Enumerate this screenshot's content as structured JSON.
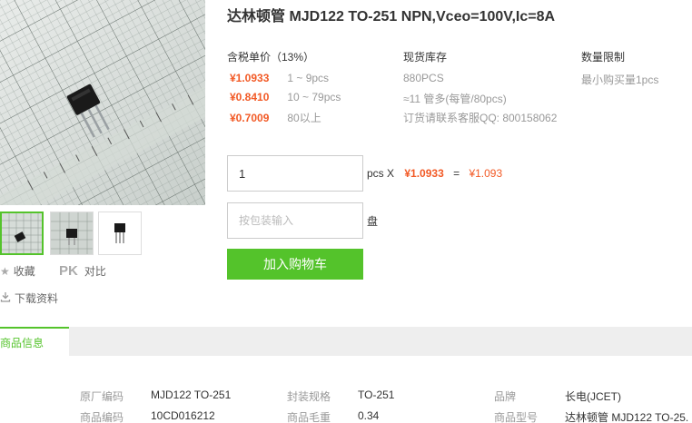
{
  "product": {
    "title": "达林顿管 MJD122 TO-251 NPN,Vceo=100V,Ic=8A"
  },
  "gallery": {
    "main_image_icon": "product-photo-transistor-on-ruler",
    "thumbnails": [
      "thumb-grid-top-view",
      "thumb-grid-side-view",
      "thumb-white-background"
    ]
  },
  "side_actions": {
    "favorite_label": "收藏",
    "pk_mark": "PK",
    "compare_label": "对比",
    "download_label": "下载资料"
  },
  "pricing": {
    "header": "含税单价（13%）",
    "tiers": [
      {
        "price": "¥1.0933",
        "range": "1 ~ 9pcs"
      },
      {
        "price": "¥0.8410",
        "range": "10 ~ 79pcs"
      },
      {
        "price": "¥0.7009",
        "range": "80以上"
      }
    ]
  },
  "stock": {
    "header": "现货库存",
    "lines": [
      "880PCS",
      "≈11 管多(每管/80pcs)",
      "订货请联系客服QQ: 800158062"
    ]
  },
  "limit": {
    "header": "数量限制",
    "text": "最小购买量1pcs"
  },
  "order": {
    "quantity_value": "1",
    "quantity_unit": "pcs X",
    "unit_price": "¥1.0933",
    "equals": "=",
    "total": "¥1.093",
    "pack_placeholder": "按包装输入",
    "pack_unit": "盘",
    "add_to_cart": "加入购物车"
  },
  "tabs": {
    "active": "商品信息"
  },
  "specs": {
    "row1": [
      {
        "label": "原厂编码",
        "value": "MJD122 TO-251"
      },
      {
        "label": "封装规格",
        "value": "TO-251"
      },
      {
        "label": "品牌",
        "value": "长电(JCET)"
      }
    ],
    "row2": [
      {
        "label": "商品编码",
        "value": "10CD016212"
      },
      {
        "label": "商品毛重",
        "value": "0.34"
      },
      {
        "label": "商品型号",
        "value": "达林顿管 MJD122 TO-25."
      }
    ]
  },
  "colors": {
    "accent_green": "#54c32b",
    "price_orange": "#f25a26"
  }
}
